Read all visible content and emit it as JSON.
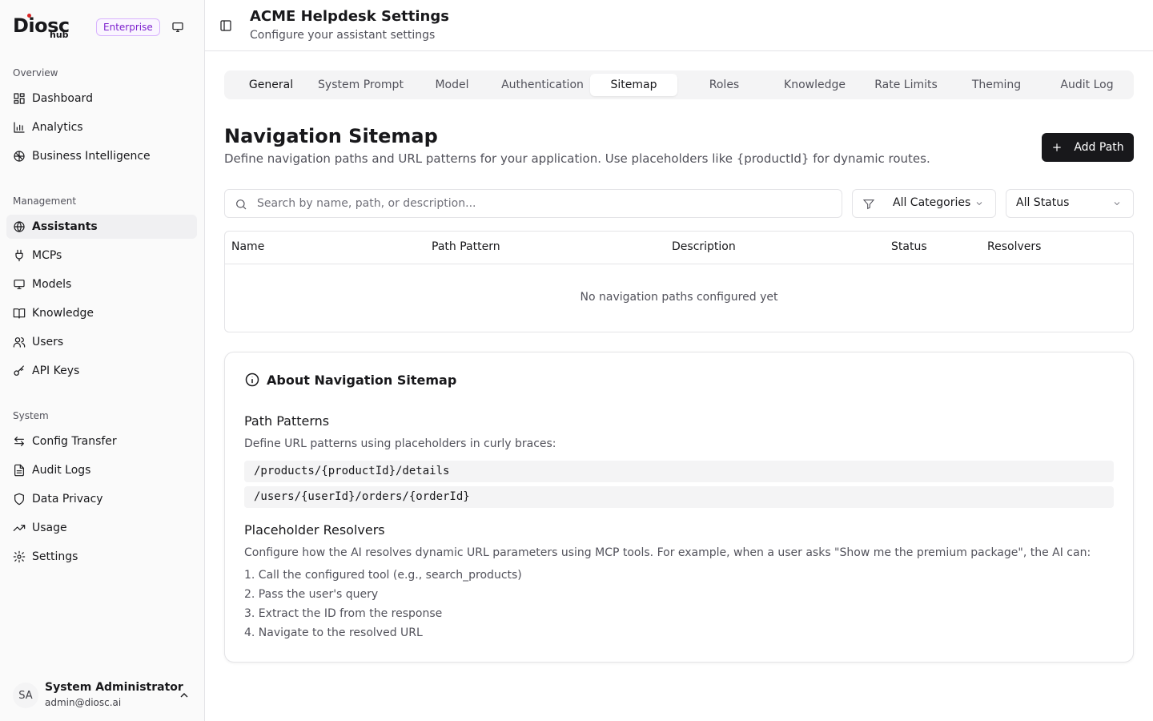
{
  "brand": {
    "name": "Diosc",
    "sub": "hub",
    "badge": "Enterprise"
  },
  "sidebar": {
    "sections": [
      {
        "label": "Overview",
        "items": [
          {
            "label": "Dashboard",
            "icon": "dashboard-icon"
          },
          {
            "label": "Analytics",
            "icon": "bar-chart-icon"
          },
          {
            "label": "Business Intelligence",
            "icon": "brain-icon"
          }
        ]
      },
      {
        "label": "Management",
        "items": [
          {
            "label": "Assistants",
            "icon": "globe-icon",
            "active": true
          },
          {
            "label": "MCPs",
            "icon": "plug-icon"
          },
          {
            "label": "Models",
            "icon": "monitor-icon"
          },
          {
            "label": "Knowledge",
            "icon": "book-icon"
          },
          {
            "label": "Users",
            "icon": "users-icon"
          },
          {
            "label": "API Keys",
            "icon": "key-icon"
          }
        ]
      },
      {
        "label": "System",
        "items": [
          {
            "label": "Config Transfer",
            "icon": "transfer-icon"
          },
          {
            "label": "Audit Logs",
            "icon": "file-icon"
          },
          {
            "label": "Data Privacy",
            "icon": "shield-icon"
          },
          {
            "label": "Usage",
            "icon": "trend-icon"
          },
          {
            "label": "Settings",
            "icon": "gear-icon"
          }
        ]
      }
    ]
  },
  "user": {
    "initials": "SA",
    "name": "System Administrator",
    "email": "admin@diosc.ai"
  },
  "header": {
    "title": "ACME Helpdesk Settings",
    "subtitle": "Configure your assistant settings"
  },
  "tabs": [
    {
      "label": "General"
    },
    {
      "label": "System Prompt"
    },
    {
      "label": "Model"
    },
    {
      "label": "Authentication"
    },
    {
      "label": "Sitemap",
      "active": true
    },
    {
      "label": "Roles"
    },
    {
      "label": "Knowledge"
    },
    {
      "label": "Rate Limits"
    },
    {
      "label": "Theming"
    },
    {
      "label": "Audit Log"
    }
  ],
  "page": {
    "title": "Navigation Sitemap",
    "description": "Define navigation paths and URL patterns for your application. Use placeholders like {productId} for dynamic routes.",
    "add_button": "Add Path"
  },
  "filters": {
    "search_placeholder": "Search by name, path, or description...",
    "search_value": "",
    "category": "All Categories",
    "status": "All Status"
  },
  "table": {
    "columns": [
      "Name",
      "Path Pattern",
      "Description",
      "Status",
      "Resolvers"
    ],
    "empty": "No navigation paths configured yet"
  },
  "about": {
    "title": "About Navigation Sitemap",
    "patterns_heading": "Path Patterns",
    "patterns_text": "Define URL patterns using placeholders in curly braces:",
    "examples": [
      "/products/{productId}/details",
      "/users/{userId}/orders/{orderId}"
    ],
    "resolvers_heading": "Placeholder Resolvers",
    "resolvers_text": "Configure how the AI resolves dynamic URL parameters using MCP tools. For example, when a user asks \"Show me the premium package\", the AI can:",
    "steps": [
      "1. Call the configured tool (e.g., search_products)",
      "2. Pass the user's query",
      "3. Extract the ID from the response",
      "4. Navigate to the resolved URL"
    ]
  }
}
